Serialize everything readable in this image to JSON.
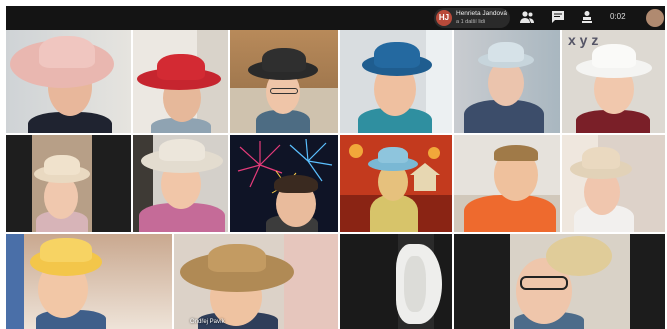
{
  "meeting": {
    "presenter_initials": "HJ",
    "presenter_name": "Henrieta Jandová",
    "presenter_sub": "a 1 další lidi",
    "clock": "0:02"
  },
  "icons": {
    "participants": "people-icon",
    "chat": "chat-icon",
    "activities": "activities-icon"
  },
  "tiles": {
    "t15_label": "Ondřej Pavík"
  }
}
